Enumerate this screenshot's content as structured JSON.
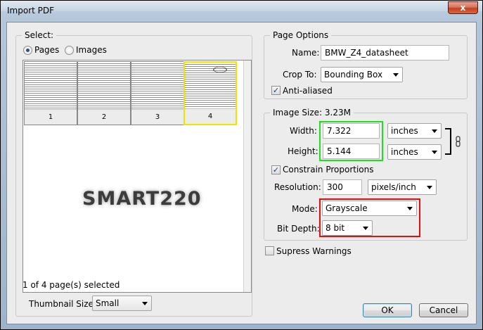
{
  "window": {
    "title": "Import PDF",
    "close_glyph": "x"
  },
  "select_group": {
    "label": "Select:",
    "radio_pages": "Pages",
    "radio_images": "Images",
    "selected_radio": "pages",
    "thumbnails": [
      {
        "label": "1",
        "selected": false
      },
      {
        "label": "2",
        "selected": false
      },
      {
        "label": "3",
        "selected": false
      },
      {
        "label": "4",
        "selected": true
      }
    ],
    "watermark": "SMART220",
    "status": "1 of 4 page(s) selected",
    "thumbnail_size_label": "Thumbnail Size:",
    "thumbnail_size_value": "Small"
  },
  "page_options": {
    "label": "Page Options",
    "name_label": "Name:",
    "name_value": "BMW_Z4_datasheet",
    "crop_label": "Crop To:",
    "crop_value": "Bounding Box",
    "anti_aliased_label": "Anti-aliased",
    "anti_aliased_checked": true
  },
  "image_size": {
    "label": "Image Size: 3.23M",
    "width_label": "Width:",
    "width_value": "7.322",
    "width_unit": "inches",
    "height_label": "Height:",
    "height_value": "5.144",
    "height_unit": "inches",
    "constrain_label": "Constrain Proportions",
    "constrain_checked": true,
    "resolution_label": "Resolution:",
    "resolution_value": "300",
    "resolution_unit": "pixels/inch",
    "mode_label": "Mode:",
    "mode_value": "Grayscale",
    "bitdepth_label": "Bit Depth:",
    "bitdepth_value": "8 bit"
  },
  "suppress_warnings": {
    "label": "Supress Warnings",
    "checked": false
  },
  "buttons": {
    "ok": "OK",
    "cancel": "Cancel"
  },
  "colors": {
    "highlight_green": "#22dd22",
    "highlight_red": "#dd1111",
    "selected_thumb": "#f2e200"
  }
}
